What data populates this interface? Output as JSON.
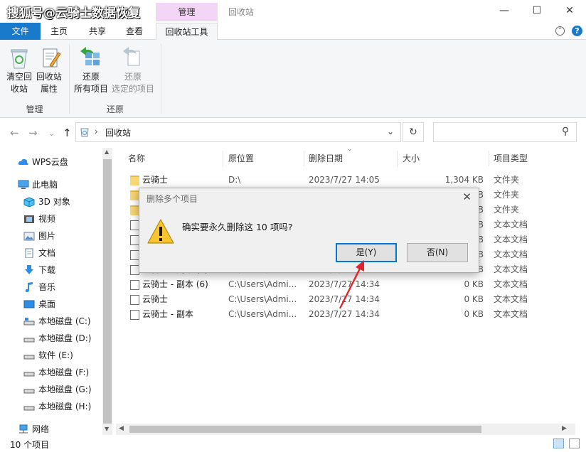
{
  "watermark": "搜狐号@云骑士数据恢复",
  "window": {
    "context_tab_header": "管理",
    "title": "回收站",
    "minimize": "—",
    "maximize": "☐",
    "close": "✕"
  },
  "tabs": [
    "文件",
    "主页",
    "共享",
    "查看",
    "回收站工具"
  ],
  "ribbon": {
    "buttons": [
      {
        "line1": "清空回",
        "line2": "收站"
      },
      {
        "line1": "回收站",
        "line2": "属性"
      },
      {
        "line1": "还原",
        "line2": "所有项目"
      },
      {
        "line1": "还原",
        "line2": "选定的项目"
      }
    ],
    "groups": [
      "管理",
      "还原"
    ]
  },
  "address": {
    "path": "回收站",
    "back": "←",
    "forward": "→",
    "history": "⌄",
    "up": "↑",
    "chevron": "›",
    "dropdown": "⌄",
    "refresh": "↻",
    "search_icon": "⚲"
  },
  "nav": [
    {
      "label": "WPS云盘",
      "icon": "cloud-icon"
    },
    {
      "label": "此电脑",
      "icon": "computer-icon"
    },
    {
      "label": "3D 对象",
      "icon": "cube-icon"
    },
    {
      "label": "视频",
      "icon": "video-icon"
    },
    {
      "label": "图片",
      "icon": "picture-icon"
    },
    {
      "label": "文档",
      "icon": "document-icon"
    },
    {
      "label": "下载",
      "icon": "download-icon"
    },
    {
      "label": "音乐",
      "icon": "music-icon"
    },
    {
      "label": "桌面",
      "icon": "desktop-icon"
    },
    {
      "label": "本地磁盘 (C:)",
      "icon": "drive-icon"
    },
    {
      "label": "本地磁盘 (D:)",
      "icon": "drive-icon"
    },
    {
      "label": "软件 (E:)",
      "icon": "drive-icon"
    },
    {
      "label": "本地磁盘 (F:)",
      "icon": "drive-icon"
    },
    {
      "label": "本地磁盘 (G:)",
      "icon": "drive-icon"
    },
    {
      "label": "本地磁盘 (H:)",
      "icon": "drive-icon"
    },
    {
      "label": "网络",
      "icon": "network-icon"
    }
  ],
  "columns": [
    "名称",
    "原位置",
    "删除日期",
    "大小",
    "项目类型"
  ],
  "files": [
    {
      "name": "云骑士",
      "location": "D:\\",
      "date": "2023/7/27 14:05",
      "size": "1,304 KB",
      "type": "文件夹",
      "kind": "folder"
    },
    {
      "name": "",
      "location": "",
      "date": "",
      "size": "KB",
      "type": "文件夹",
      "kind": "folder"
    },
    {
      "name": "",
      "location": "",
      "date": "",
      "size": "KB",
      "type": "文件夹",
      "kind": "folder"
    },
    {
      "name": "",
      "location": "",
      "date": "",
      "size": "KB",
      "type": "文本文档",
      "kind": "doc"
    },
    {
      "name": "",
      "location": "",
      "date": "",
      "size": "KB",
      "type": "文本文档",
      "kind": "doc"
    },
    {
      "name": "",
      "location": "",
      "date": "",
      "size": "KB",
      "type": "文本文档",
      "kind": "doc"
    },
    {
      "name": "云骑士 - 副本 (7)",
      "location": "C:\\Users\\Admi...",
      "date": "2023/7/27 14:34",
      "size": "0 KB",
      "type": "文本文档",
      "kind": "doc"
    },
    {
      "name": "云骑士 - 副本 (6)",
      "location": "C:\\Users\\Admi...",
      "date": "2023/7/27 14:34",
      "size": "0 KB",
      "type": "文本文档",
      "kind": "doc"
    },
    {
      "name": "云骑士",
      "location": "C:\\Users\\Admi...",
      "date": "2023/7/27 14:34",
      "size": "0 KB",
      "type": "文本文档",
      "kind": "doc"
    },
    {
      "name": "云骑士 - 副本",
      "location": "C:\\Users\\Admi...",
      "date": "2023/7/27 14:34",
      "size": "0 KB",
      "type": "文本文档",
      "kind": "doc"
    }
  ],
  "status": "10 个项目",
  "dialog": {
    "title": "删除多个项目",
    "message": "确实要永久删除这 10 项吗?",
    "yes": "是(Y)",
    "no": "否(N)",
    "close": "✕"
  },
  "colors": {
    "accent": "#1979ca",
    "context_tab": "#f3d6f5",
    "annotation_arrow": "#e0262d"
  }
}
